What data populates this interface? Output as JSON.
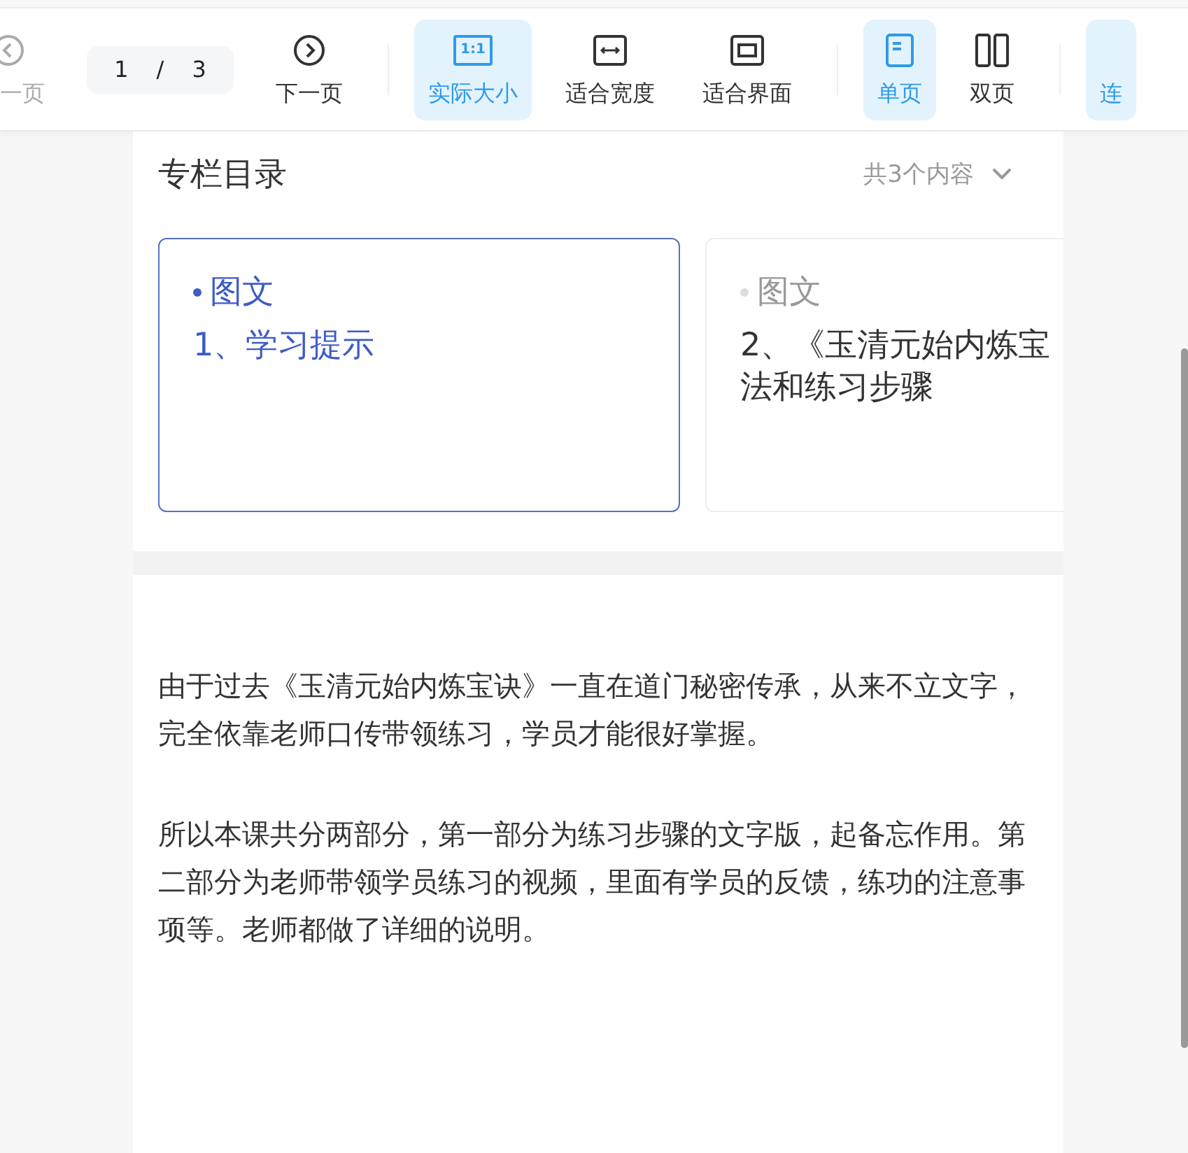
{
  "toolbar": {
    "items": [
      {
        "kind": "prev",
        "label": "一页",
        "disabled": true,
        "selected": false
      },
      {
        "kind": "pager",
        "current": "1",
        "separator": "/",
        "total": "3"
      },
      {
        "kind": "next",
        "label": "下一页",
        "disabled": false,
        "selected": false
      },
      {
        "kind": "divider"
      },
      {
        "kind": "actual",
        "icon_text": "1:1",
        "label": "实际大小",
        "disabled": false,
        "selected": true
      },
      {
        "kind": "fitwidth",
        "label": "适合宽度",
        "disabled": false,
        "selected": false
      },
      {
        "kind": "fitscreen",
        "label": "适合界面",
        "disabled": false,
        "selected": false
      },
      {
        "kind": "divider"
      },
      {
        "kind": "single",
        "label": "单页",
        "disabled": false,
        "selected": true
      },
      {
        "kind": "double",
        "label": "双页",
        "disabled": false,
        "selected": false
      },
      {
        "kind": "divider"
      },
      {
        "kind": "continuous",
        "label": "连",
        "disabled": false,
        "selected": true
      }
    ]
  },
  "catalog": {
    "title": "专栏目录",
    "count": "共3个内容",
    "cards": [
      {
        "type": "图文",
        "title_lines": [
          "1、学习提示"
        ],
        "selected": true
      },
      {
        "type": "图文",
        "title_lines": [
          "2、《玉清元始内炼宝",
          "法和练习步骤"
        ],
        "selected": false
      }
    ]
  },
  "paragraphs": [
    "由于过去《玉清元始内炼宝诀》一直在道门秘密传承，从来不立文字，完全依靠老师口传带领练习，学员才能很好掌握。",
    "所以本课共分两部分，第一部分为练习步骤的文字版，起备忘作用。第二部分为老师带领学员练习的视频，里面有学员的反馈，练功的注意事项等。老师都做了详细的说明。"
  ]
}
